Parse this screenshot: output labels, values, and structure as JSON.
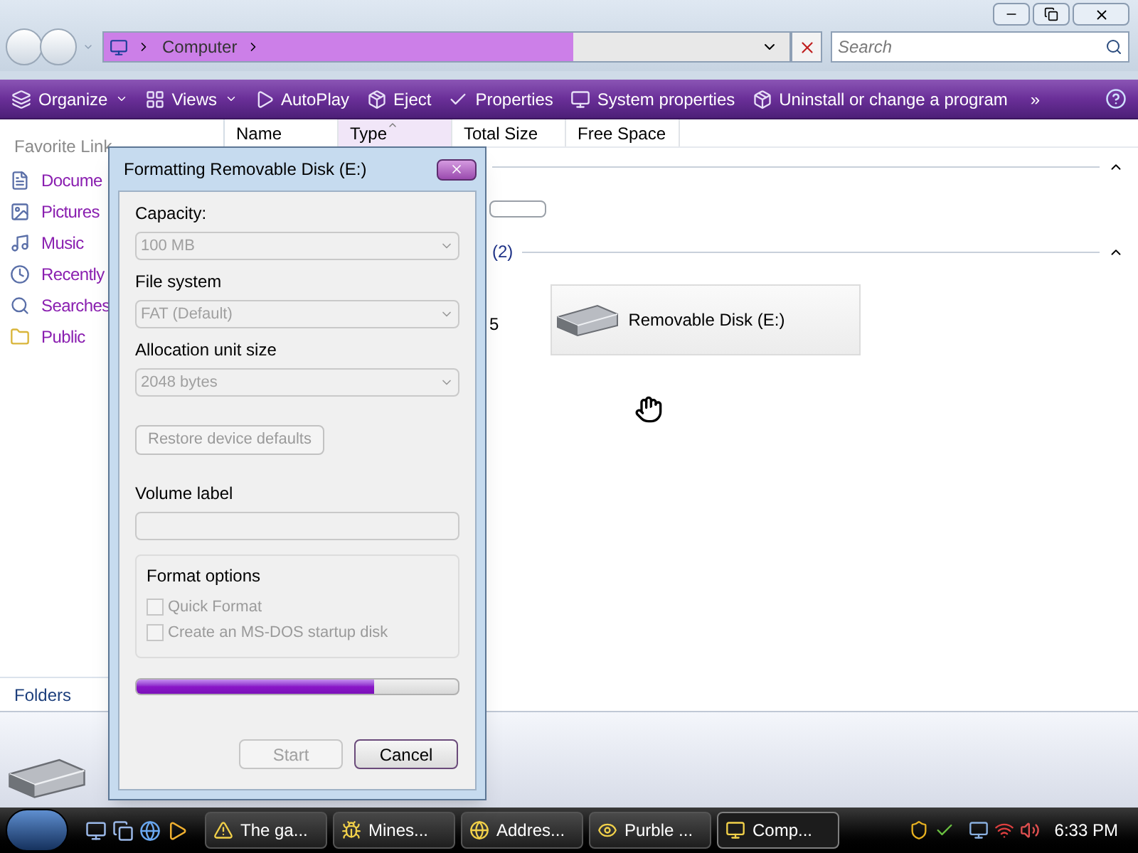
{
  "address_bar": {
    "path": [
      "Computer"
    ]
  },
  "search": {
    "placeholder": "Search"
  },
  "toolbar": [
    {
      "kind": "organize",
      "label": "Organize",
      "dropdown": true
    },
    {
      "kind": "views",
      "label": "Views",
      "dropdown": true
    },
    {
      "kind": "autoplay",
      "label": "AutoPlay",
      "dropdown": false
    },
    {
      "kind": "eject",
      "label": "Eject",
      "dropdown": false
    },
    {
      "kind": "properties",
      "label": "Properties",
      "dropdown": false
    },
    {
      "kind": "system",
      "label": "System properties",
      "dropdown": false
    },
    {
      "kind": "uninstall",
      "label": "Uninstall or change a program",
      "dropdown": false
    }
  ],
  "toolbar_more": "»",
  "columns": [
    {
      "label": "Name",
      "selected": false
    },
    {
      "label": "Type",
      "selected": true
    },
    {
      "label": "Total Size",
      "selected": false
    },
    {
      "label": "Free Space",
      "selected": false
    }
  ],
  "sidebar": {
    "heading": "Favorite Link",
    "items": [
      {
        "kind": "documents",
        "label": "Docume"
      },
      {
        "kind": "pictures",
        "label": "Pictures"
      },
      {
        "kind": "music",
        "label": "Music"
      },
      {
        "kind": "recent",
        "label": "Recently"
      },
      {
        "kind": "searches",
        "label": "Searches"
      },
      {
        "kind": "public",
        "label": "Public"
      }
    ],
    "footer": "Folders"
  },
  "sections": [
    {
      "expanded": true,
      "items": [
        {
          "kind": "bar"
        }
      ]
    },
    {
      "title": "(2)",
      "expanded": true,
      "items": [
        {
          "kind": "text",
          "label": "5"
        },
        {
          "kind": "drive",
          "label": "Removable Disk (E:)"
        }
      ]
    }
  ],
  "dialog": {
    "title": "Formatting Removable Disk (E:)",
    "fields": [
      {
        "label": "Capacity:",
        "value": "100 MB",
        "disabled": true
      },
      {
        "label": "File system",
        "value": "FAT (Default)",
        "disabled": true
      },
      {
        "label": "Allocation unit size",
        "value": "2048 bytes",
        "disabled": true
      }
    ],
    "restore_button": {
      "label": "Restore device defaults",
      "disabled": true
    },
    "volume_label": {
      "label": "Volume label",
      "disabled": true
    },
    "format_options": {
      "title": "Format options",
      "options": [
        {
          "label": "Quick Format",
          "checked": false,
          "disabled": true
        },
        {
          "label": "Create an MS-DOS startup disk",
          "checked": false,
          "disabled": true
        }
      ]
    },
    "progress": {
      "level": 0.74
    },
    "buttons": [
      {
        "label": "Start",
        "disabled": true
      },
      {
        "label": "Cancel",
        "disabled": false
      }
    ]
  },
  "taskbar": {
    "tasks": [
      {
        "kind": "warning",
        "label": "The ga...",
        "selected": false
      },
      {
        "kind": "mines",
        "label": "Mines...",
        "selected": false
      },
      {
        "kind": "ie",
        "label": "Addres...",
        "selected": false
      },
      {
        "kind": "purble",
        "label": "Purble ...",
        "selected": false
      },
      {
        "kind": "computer",
        "label": "Comp...",
        "selected": true
      }
    ],
    "clock": "6:33 PM"
  }
}
